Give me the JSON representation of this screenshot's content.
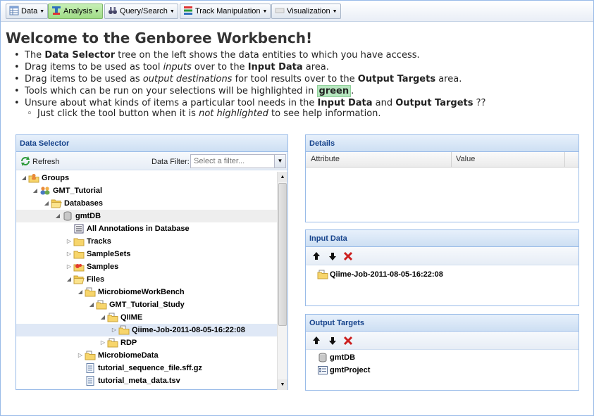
{
  "toolbar": {
    "buttons": [
      {
        "label": "Data",
        "icon": "table-icon"
      },
      {
        "label": "Analysis",
        "icon": "analysis-icon"
      },
      {
        "label": "Query/Search",
        "icon": "binoculars-icon"
      },
      {
        "label": "Track Manipulation",
        "icon": "tracks-icon"
      },
      {
        "label": "Visualization",
        "icon": "visualization-icon"
      }
    ],
    "active_button": "Analysis",
    "active_color": "#a9e08f"
  },
  "welcome": {
    "title": "Welcome to the Genboree Workbench!",
    "bullets": [
      {
        "parts": [
          [
            "t",
            "The "
          ],
          [
            "b",
            "Data Selector"
          ],
          [
            "t",
            " tree on the left shows the data entities to which you have access."
          ]
        ]
      },
      {
        "parts": [
          [
            "t",
            "Drag items to be used as tool "
          ],
          [
            "i",
            "inputs"
          ],
          [
            "t",
            " over to the "
          ],
          [
            "b",
            "Input Data"
          ],
          [
            "t",
            " area."
          ]
        ]
      },
      {
        "parts": [
          [
            "t",
            "Drag items to be used as "
          ],
          [
            "i",
            "output destinations"
          ],
          [
            "t",
            " for tool results over to the "
          ],
          [
            "b",
            "Output Targets"
          ],
          [
            "t",
            " area."
          ]
        ]
      },
      {
        "parts": [
          [
            "t",
            "Tools which can be run on your selections will be highlighted in "
          ],
          [
            "g",
            "green"
          ],
          [
            "t",
            "."
          ]
        ]
      },
      {
        "parts": [
          [
            "t",
            "Unsure about what kinds of items a particular tool needs in the "
          ],
          [
            "b",
            "Input Data"
          ],
          [
            "t",
            " and "
          ],
          [
            "b",
            "Output Targets"
          ],
          [
            "t",
            " ??"
          ]
        ]
      }
    ],
    "sub_bullet": {
      "parts": [
        [
          "t",
          "Just click the tool button when it is "
        ],
        [
          "i",
          "not highlighted"
        ],
        [
          "t",
          " to see help information."
        ]
      ]
    }
  },
  "data_selector": {
    "title": "Data Selector",
    "refresh_label": "Refresh",
    "filter_label": "Data Filter:",
    "filter_placeholder": "Select a filter...",
    "tree": [
      {
        "label": "Groups",
        "depth": 0,
        "state": "open",
        "icon": "group-folder-icon"
      },
      {
        "label": "GMT_Tutorial",
        "depth": 1,
        "state": "open",
        "icon": "group-icon"
      },
      {
        "label": "Databases",
        "depth": 2,
        "state": "open",
        "icon": "folder-open-icon"
      },
      {
        "label": "gmtDB",
        "depth": 3,
        "state": "open",
        "icon": "database-icon",
        "highlight": true
      },
      {
        "label": "All Annotations in Database",
        "depth": 4,
        "state": "leaf",
        "icon": "annotations-icon"
      },
      {
        "label": "Tracks",
        "depth": 4,
        "state": "closed",
        "icon": "folder-icon"
      },
      {
        "label": "SampleSets",
        "depth": 4,
        "state": "closed",
        "icon": "folder-icon"
      },
      {
        "label": "Samples",
        "depth": 4,
        "state": "closed",
        "icon": "samples-icon"
      },
      {
        "label": "Files",
        "depth": 4,
        "state": "open",
        "icon": "folder-open-icon"
      },
      {
        "label": "MicrobiomeWorkBench",
        "depth": 5,
        "state": "open",
        "icon": "folder-file-icon"
      },
      {
        "label": "GMT_Tutorial_Study",
        "depth": 6,
        "state": "open",
        "icon": "folder-file-icon"
      },
      {
        "label": "QIIME",
        "depth": 7,
        "state": "open",
        "icon": "folder-file-icon"
      },
      {
        "label": "Qiime-Job-2011-08-05-16:22:08",
        "depth": 8,
        "state": "closed",
        "icon": "folder-file-icon",
        "selected": true
      },
      {
        "label": "RDP",
        "depth": 7,
        "state": "closed",
        "icon": "folder-file-icon"
      },
      {
        "label": "MicrobiomeData",
        "depth": 5,
        "state": "closed",
        "icon": "folder-file-icon"
      },
      {
        "label": "tutorial_sequence_file.sff.gz",
        "depth": 5,
        "state": "leaf",
        "icon": "file-icon"
      },
      {
        "label": "tutorial_meta_data.tsv",
        "depth": 5,
        "state": "leaf",
        "icon": "file-icon"
      }
    ]
  },
  "details": {
    "title": "Details",
    "columns": [
      "Attribute",
      "Value"
    ]
  },
  "input_data": {
    "title": "Input Data",
    "items": [
      {
        "label": "Qiime-Job-2011-08-05-16:22:08",
        "icon": "folder-file-icon"
      }
    ]
  },
  "output_targets": {
    "title": "Output Targets",
    "items": [
      {
        "label": "gmtDB",
        "icon": "database-icon"
      },
      {
        "label": "gmtProject",
        "icon": "project-icon"
      }
    ]
  }
}
